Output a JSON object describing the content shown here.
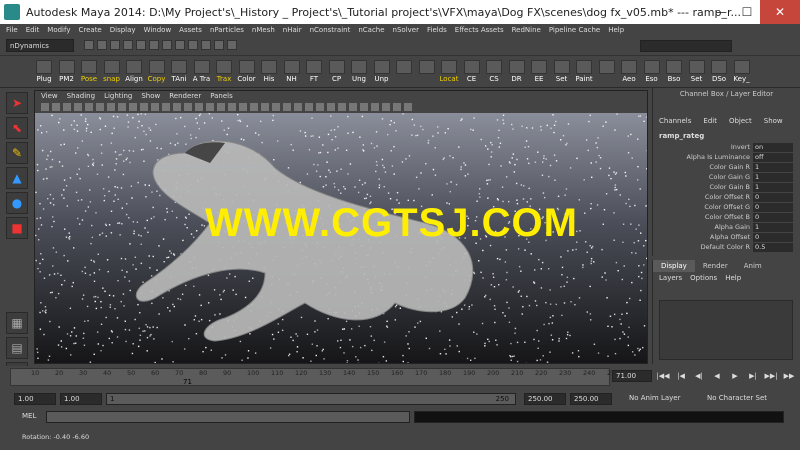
{
  "window": {
    "title": "Autodesk Maya 2014: D:\\My Project's\\_History _ Project's\\_Tutorial project's\\VFX\\maya\\Dog FX\\scenes\\dog fx_v05.mb*   ---   ramp_r...",
    "minimize": "—",
    "maximize": "☐",
    "close": "✕"
  },
  "menubar": [
    "File",
    "Edit",
    "Modify",
    "Create",
    "Display",
    "Window",
    "Assets",
    "nParticles",
    "nMesh",
    "nHair",
    "nConstraint",
    "nCache",
    "nSolver",
    "Fields",
    "Effects Assets",
    "RedNine",
    "Pipeline Cache",
    "Help"
  ],
  "statusline": {
    "mode": "nDynamics"
  },
  "shelf": [
    {
      "label": "Plug",
      "yellow": false
    },
    {
      "label": "PM2",
      "yellow": false
    },
    {
      "label": "Pose",
      "yellow": true
    },
    {
      "label": "snap",
      "yellow": true
    },
    {
      "label": "Align",
      "yellow": false
    },
    {
      "label": "Copy",
      "yellow": true
    },
    {
      "label": "TAni",
      "yellow": false
    },
    {
      "label": "A Tra",
      "yellow": false
    },
    {
      "label": "Trax",
      "yellow": true
    },
    {
      "label": "Color\nNode",
      "yellow": false
    },
    {
      "label": "His",
      "yellow": false
    },
    {
      "label": "NH",
      "yellow": false
    },
    {
      "label": "FT",
      "yellow": false
    },
    {
      "label": "CP",
      "yellow": false
    },
    {
      "label": "Ung",
      "yellow": false
    },
    {
      "label": "Unp",
      "yellow": false
    },
    {
      "label": "",
      "yellow": false
    },
    {
      "label": "",
      "yellow": false
    },
    {
      "label": "Locat",
      "yellow": true
    },
    {
      "label": "CE",
      "yellow": false
    },
    {
      "label": "CS",
      "yellow": false
    },
    {
      "label": "DR",
      "yellow": false
    },
    {
      "label": "EE",
      "yellow": false
    },
    {
      "label": "Set",
      "yellow": false
    },
    {
      "label": "Paint\nSkin",
      "yellow": false
    },
    {
      "label": "",
      "yellow": false
    },
    {
      "label": "Aeo",
      "yellow": false
    },
    {
      "label": "Eso",
      "yellow": false
    },
    {
      "label": "Bso",
      "yellow": false
    },
    {
      "label": "Set",
      "yellow": false
    },
    {
      "label": "DSo",
      "yellow": false
    },
    {
      "label": "Key_",
      "yellow": false
    }
  ],
  "panel_menu": [
    "View",
    "Shading",
    "Lighting",
    "Show",
    "Renderer",
    "Panels"
  ],
  "watermark": "WWW.CGTSJ.COM",
  "channel_box": {
    "header": "Channel Box / Layer Editor",
    "menu": [
      "Channels",
      "Edit",
      "Object",
      "Show"
    ],
    "object": "ramp_rateg",
    "attributes": [
      {
        "name": "Invert",
        "value": "on"
      },
      {
        "name": "Alpha Is Luminance",
        "value": "off"
      },
      {
        "name": "Color Gain R",
        "value": "1"
      },
      {
        "name": "Color Gain G",
        "value": "1"
      },
      {
        "name": "Color Gain B",
        "value": "1"
      },
      {
        "name": "Color Offset R",
        "value": "0"
      },
      {
        "name": "Color Offset G",
        "value": "0"
      },
      {
        "name": "Color Offset B",
        "value": "0"
      },
      {
        "name": "Alpha Gain",
        "value": "1"
      },
      {
        "name": "Alpha Offset",
        "value": "0"
      },
      {
        "name": "Default Color R",
        "value": "0.5"
      }
    ]
  },
  "layer_editor": {
    "tabs": [
      "Display",
      "Render",
      "Anim"
    ],
    "menu": [
      "Layers",
      "Options",
      "Help"
    ]
  },
  "timeline": {
    "ticks": [
      "10",
      "20",
      "30",
      "40",
      "50",
      "60",
      "70",
      "80",
      "90",
      "100",
      "110",
      "120",
      "130",
      "140",
      "150",
      "160",
      "170",
      "180",
      "190",
      "200",
      "210",
      "220",
      "230",
      "240",
      "250"
    ],
    "current_frame_label": "71",
    "current_frame": "71.00"
  },
  "playback": [
    "|◀◀",
    "|◀",
    "◀|",
    "◀",
    "▶",
    "▶|",
    "▶▶|",
    "▶▶"
  ],
  "range": {
    "start": "1.00",
    "start2": "1.00",
    "slider_start": "1",
    "slider_end": "250",
    "end": "250.00",
    "end2": "250.00",
    "anim_layer": "No Anim Layer",
    "char_set": "No Character Set"
  },
  "command_line": {
    "label": "MEL"
  },
  "help_line": "Rotation:  -0.40    -6.60"
}
